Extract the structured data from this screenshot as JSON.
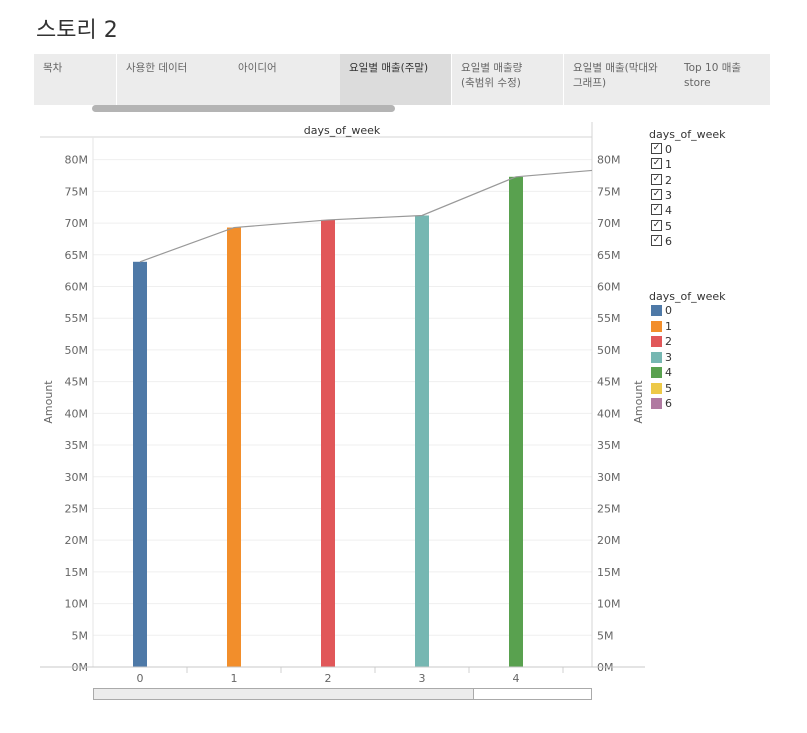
{
  "story": {
    "title": "스토리 2"
  },
  "tabs": [
    {
      "label": "목차",
      "active": false
    },
    {
      "label": "사용한 데이터",
      "active": false
    },
    {
      "label": "아이디어",
      "active": false
    },
    {
      "label": "요일별 매출(주말)",
      "active": true
    },
    {
      "label": "요일별 매출량\n(축범위 수정)",
      "active": false
    },
    {
      "label": "요일별 매출(막대와\n그래프)",
      "active": false
    },
    {
      "label": "Top 10 매출\nstore",
      "active": false
    }
  ],
  "filter_legend": {
    "title": "days_of_week",
    "items": [
      {
        "label": "0",
        "checked": true
      },
      {
        "label": "1",
        "checked": true
      },
      {
        "label": "2",
        "checked": true
      },
      {
        "label": "3",
        "checked": true
      },
      {
        "label": "4",
        "checked": true
      },
      {
        "label": "5",
        "checked": true
      },
      {
        "label": "6",
        "checked": true
      }
    ]
  },
  "color_legend": {
    "title": "days_of_week",
    "items": [
      {
        "label": "0",
        "color": "#4e79a7"
      },
      {
        "label": "1",
        "color": "#f28e2b"
      },
      {
        "label": "2",
        "color": "#e15759"
      },
      {
        "label": "3",
        "color": "#76b7b2"
      },
      {
        "label": "4",
        "color": "#59a14f"
      },
      {
        "label": "5",
        "color": "#edc948"
      },
      {
        "label": "6",
        "color": "#b07aa1"
      }
    ]
  },
  "chart_data": {
    "type": "bar",
    "title": "days_of_week",
    "xlabel": "",
    "ylabel": "Amount",
    "y2label": "Amount",
    "ylim": [
      0,
      82000000
    ],
    "yticks": [
      0,
      5000000,
      10000000,
      15000000,
      20000000,
      25000000,
      30000000,
      35000000,
      40000000,
      45000000,
      50000000,
      55000000,
      60000000,
      65000000,
      70000000,
      75000000,
      80000000
    ],
    "ytick_labels": [
      "0M",
      "5M",
      "10M",
      "15M",
      "20M",
      "25M",
      "30M",
      "35M",
      "40M",
      "45M",
      "50M",
      "55M",
      "60M",
      "65M",
      "70M",
      "75M",
      "80M"
    ],
    "categories": [
      "0",
      "1",
      "2",
      "3",
      "4"
    ],
    "values": [
      63900000,
      69300000,
      70500000,
      71200000,
      77300000
    ],
    "colors": [
      "#4e79a7",
      "#f28e2b",
      "#e15759",
      "#76b7b2",
      "#59a14f"
    ],
    "line_series": {
      "x": [
        "0",
        "1",
        "2",
        "3",
        "4",
        "5"
      ],
      "values": [
        63900000,
        69300000,
        70500000,
        71200000,
        77300000,
        78300000
      ],
      "color": "#999999"
    },
    "grid": true
  }
}
